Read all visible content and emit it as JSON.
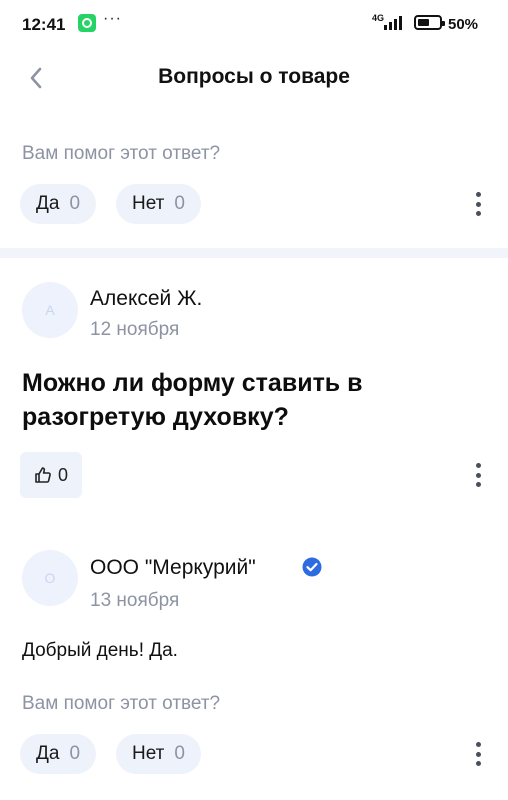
{
  "status_bar": {
    "time": "12:41",
    "network": "4G",
    "battery": "50%",
    "battery_level": 0.5,
    "app_icon": "whatsapp-icon"
  },
  "header": {
    "title": "Вопросы о товаре",
    "back_icon": "chevron-left-icon"
  },
  "previous_answer": {
    "helpful_question": "Вам помог этот ответ?",
    "yes_label": "Да",
    "yes_count": "0",
    "no_label": "Нет",
    "no_count": "0"
  },
  "question": {
    "avatar_letter": "А",
    "author": "Алексей Ж.",
    "date": "12 ноября",
    "text": "Можно ли форму ставить в разогретую духовку?",
    "likes": "0",
    "like_icon": "thumbs-up-icon"
  },
  "answer": {
    "avatar_letter": "О",
    "author": "ООО \"Меркурий\"",
    "verified_icon": "verified-check-icon",
    "date": "13 ноября",
    "text": "Добрый день! Да.",
    "helpful_question": "Вам помог этот ответ?",
    "yes_label": "Да",
    "yes_count": "0",
    "no_label": "Нет",
    "no_count": "0"
  },
  "colors": {
    "pill_bg": "#eef2fb",
    "muted_text": "#8d93a3",
    "verified": "#2f6be0",
    "whatsapp": "#25d366"
  }
}
